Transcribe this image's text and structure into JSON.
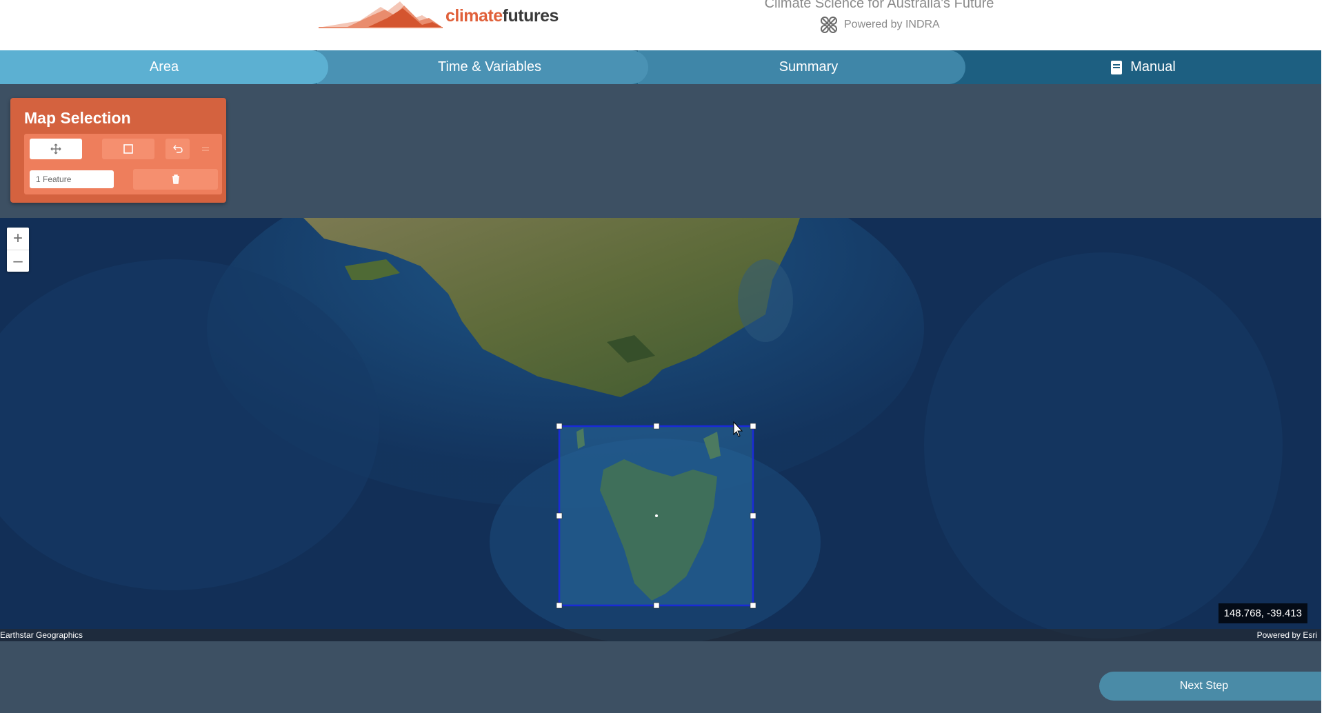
{
  "header": {
    "logo_prefix": "climate",
    "logo_suffix": "futures",
    "tagline": "Climate Science for Australia's Future",
    "powered_by": "Powered by INDRA"
  },
  "tabs": [
    {
      "label": "Area",
      "active": true
    },
    {
      "label": "Time & Variables",
      "active": false
    },
    {
      "label": "Summary",
      "active": false
    },
    {
      "label": "Manual",
      "icon": "book-icon"
    }
  ],
  "map_selection": {
    "title": "Map Selection",
    "tools": [
      {
        "icon": "move-icon"
      },
      {
        "icon": "rectangle-icon"
      },
      {
        "icon": "undo-icon"
      },
      {
        "icon": "redo-icon"
      }
    ],
    "feature_count": "1 Feature",
    "delete_icon": "trash-icon"
  },
  "map": {
    "zoom_in": "+",
    "zoom_out": "–",
    "coordinates": "148.768, -39.413",
    "attribution_left": "Earthstar Geographics",
    "attribution_right": "Powered by Esri"
  },
  "footer": {
    "next_step": "Next Step"
  },
  "colors": {
    "brand_orange": "#e0603a",
    "panel_orange": "#d4623f",
    "tab_active": "#5cb0d2",
    "tab_bar": "#1d5f81",
    "page_bg": "#3d5063",
    "selection_blue": "#1a2bd6"
  }
}
